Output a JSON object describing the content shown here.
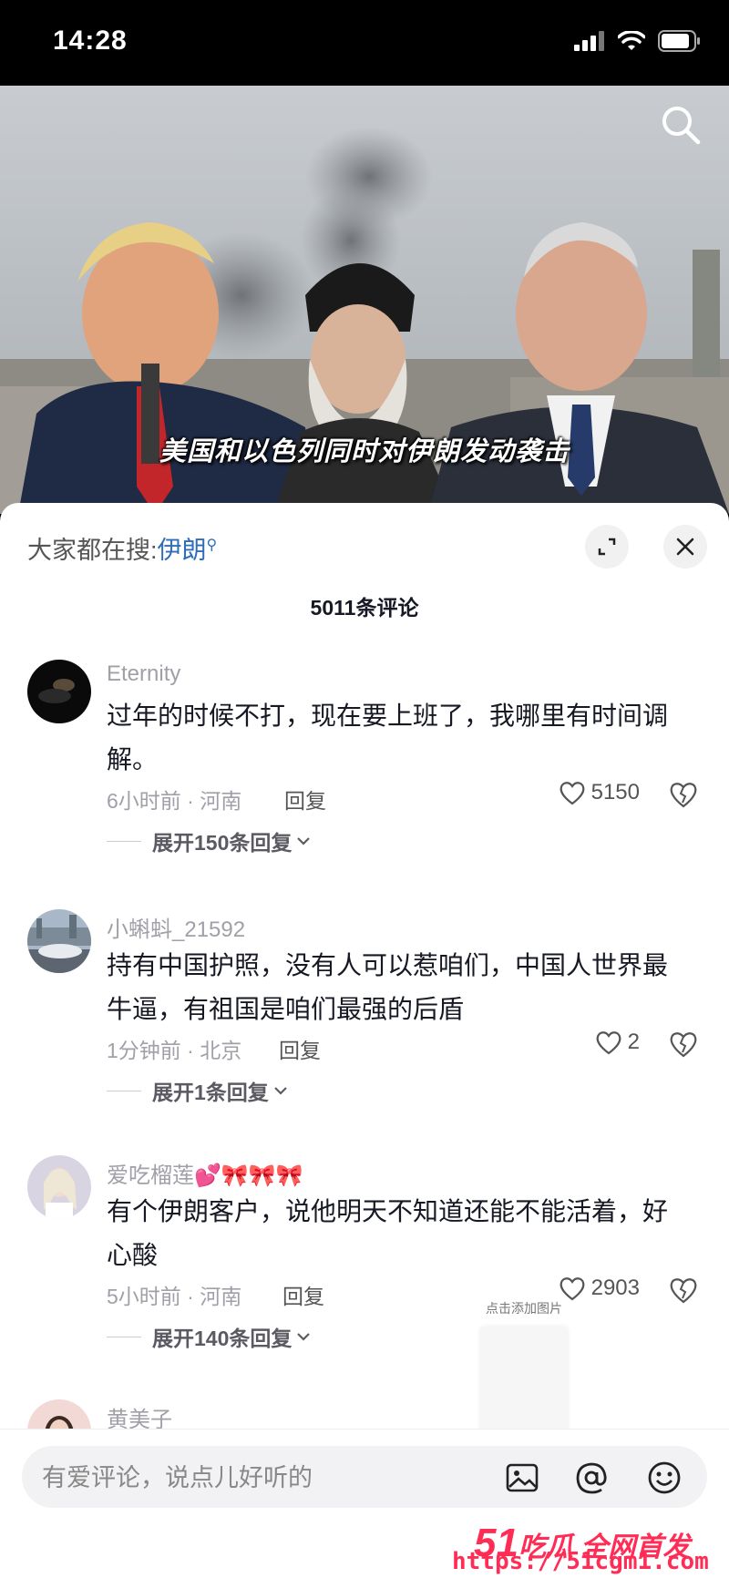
{
  "status_bar": {
    "time": "14:28"
  },
  "video": {
    "caption": "美国和以色列同时对伊朗发动袭击"
  },
  "panel": {
    "trending_prefix": "大家都在搜:",
    "trending_keyword": "伊朗",
    "comment_count": "5011条评论"
  },
  "comments": [
    {
      "user": "Eternity",
      "text": "过年的时候不打，现在要上班了，我哪里有时间调解。",
      "meta": "6小时前 · 河南",
      "reply": "回复",
      "likes": "5150",
      "expand": "展开150条回复"
    },
    {
      "user": "小蝌蚪_21592",
      "text": "持有中国护照，没有人可以惹咱们，中国人世界最牛逼，有祖国是咱们最强的后盾",
      "meta": "1分钟前 · 北京",
      "reply": "回复",
      "likes": "2",
      "expand": "展开1条回复"
    },
    {
      "user": "爱吃榴莲💕🎀🎀🎀",
      "text": "有个伊朗客户，说他明天不知道还能不能活着，好心酸",
      "meta": "5小时前 · 河南",
      "reply": "回复",
      "likes": "2903",
      "expand": "展开140条回复"
    },
    {
      "user": "黄美子"
    }
  ],
  "float_preview": {
    "hint": "点击添加图片"
  },
  "input": {
    "placeholder": "有爱评论，说点儿好听的"
  },
  "watermark": {
    "brand_num": "51",
    "brand_text": "吃瓜 全网首发",
    "url": "https://51cgm1.com"
  },
  "colors": {
    "accent": "#2f6db8",
    "watermark": "#ff2d55"
  }
}
